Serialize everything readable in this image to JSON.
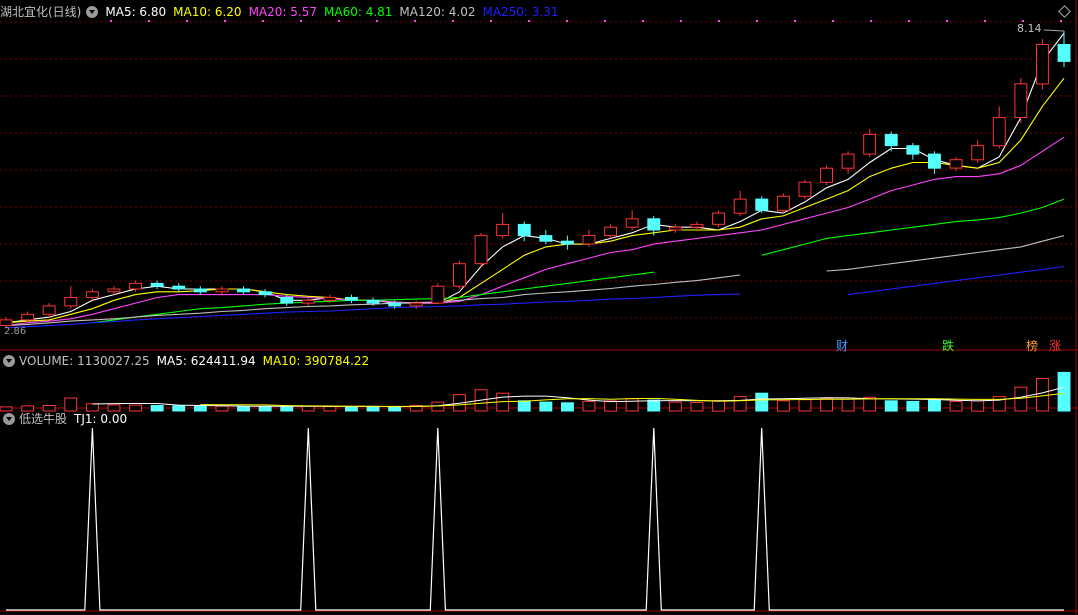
{
  "stock": {
    "name": "湖北宜化(日线)"
  },
  "main_legend": [
    {
      "label": "MA5: 6.80",
      "color": "#ffffff"
    },
    {
      "label": "MA10: 6.20",
      "color": "#ffff00"
    },
    {
      "label": "MA20: 5.57",
      "color": "#ff44ff"
    },
    {
      "label": "MA60: 4.81",
      "color": "#00ff00"
    },
    {
      "label": "MA120: 4.02",
      "color": "#c0c0c0"
    },
    {
      "label": "MA250: 3.31",
      "color": "#2020ff"
    }
  ],
  "volume_legend": {
    "volume": "VOLUME: 1130027.25",
    "ma5": "MA5: 624411.94",
    "ma10": "MA10: 390784.22"
  },
  "indicator_legend": {
    "name": "低选牛股",
    "tj1": "TJ1: 0.00"
  },
  "price_high_label": "8.14",
  "price_low_label": "2.86",
  "event_tags": [
    {
      "label": "财",
      "color": "#3aa0ff"
    },
    {
      "label": "跌",
      "color": "#33ff33"
    },
    {
      "label": "榜",
      "color": "#ff9933"
    },
    {
      "label": "涨",
      "color": "#ff3333"
    }
  ],
  "colors": {
    "up": "#ff3333",
    "down": "#54ffff",
    "grid": "#7a0000",
    "divider": "#a00000"
  },
  "chart_data": [
    {
      "type": "line",
      "title": "湖北宜化(日线)",
      "series": [
        {
          "name": "MA5",
          "values": [
            2.95,
            3.0,
            3.05,
            3.15,
            3.35,
            3.45,
            3.55,
            3.6,
            3.55,
            3.55,
            3.55,
            3.55,
            3.5,
            3.35,
            3.35,
            3.4,
            3.35,
            3.35,
            3.3,
            3.3,
            3.3,
            3.5,
            3.95,
            4.3,
            4.5,
            4.45,
            4.35,
            4.35,
            4.45,
            4.55,
            4.7,
            4.65,
            4.65,
            4.6,
            4.75,
            4.95,
            4.9,
            5.1,
            5.35,
            5.5,
            5.8,
            6.05,
            6.05,
            5.85,
            5.75,
            5.7,
            5.9,
            6.6,
            7.6,
            8.1
          ]
        },
        {
          "name": "MA10",
          "values": [
            2.95,
            2.98,
            3.0,
            3.1,
            3.2,
            3.35,
            3.45,
            3.5,
            3.5,
            3.52,
            3.55,
            3.55,
            3.5,
            3.45,
            3.42,
            3.4,
            3.35,
            3.35,
            3.32,
            3.3,
            3.3,
            3.4,
            3.65,
            3.9,
            4.15,
            4.3,
            4.35,
            4.35,
            4.4,
            4.5,
            4.55,
            4.6,
            4.6,
            4.6,
            4.65,
            4.8,
            4.85,
            5.0,
            5.15,
            5.3,
            5.55,
            5.7,
            5.8,
            5.8,
            5.75,
            5.7,
            5.8,
            6.2,
            6.8,
            7.3
          ]
        },
        {
          "name": "MA20",
          "values": [
            2.9,
            2.95,
            2.98,
            3.02,
            3.1,
            3.2,
            3.3,
            3.4,
            3.45,
            3.45,
            3.45,
            3.45,
            3.45,
            3.42,
            3.4,
            3.38,
            3.35,
            3.35,
            3.32,
            3.3,
            3.3,
            3.33,
            3.45,
            3.6,
            3.75,
            3.9,
            4.0,
            4.1,
            4.2,
            4.25,
            4.35,
            4.4,
            4.45,
            4.5,
            4.55,
            4.6,
            4.7,
            4.8,
            4.9,
            5.0,
            5.15,
            5.3,
            5.4,
            5.5,
            5.55,
            5.55,
            5.6,
            5.75,
            6.0,
            6.25
          ]
        },
        {
          "name": "MA60",
          "values": [
            null,
            null,
            null,
            null,
            2.95,
            3.0,
            3.05,
            3.1,
            3.15,
            3.2,
            3.22,
            3.25,
            3.28,
            3.3,
            3.32,
            3.33,
            3.35,
            3.35,
            3.36,
            3.37,
            3.38,
            3.4,
            3.45,
            3.5,
            3.55,
            3.6,
            3.65,
            3.7,
            3.75,
            3.8,
            3.85,
            null,
            null,
            null,
            null,
            4.15,
            4.25,
            4.35,
            4.45,
            4.5,
            4.55,
            4.6,
            4.65,
            4.7,
            4.75,
            4.78,
            4.82,
            4.9,
            5.0,
            5.15
          ]
        },
        {
          "name": "MA120",
          "values": [
            2.9,
            2.92,
            2.95,
            2.98,
            3.0,
            3.02,
            3.05,
            3.08,
            3.1,
            3.12,
            3.15,
            3.17,
            3.2,
            3.22,
            3.24,
            3.25,
            3.27,
            3.28,
            3.3,
            3.31,
            3.32,
            3.35,
            3.38,
            3.4,
            3.45,
            3.48,
            3.5,
            3.53,
            3.56,
            3.6,
            3.63,
            3.67,
            3.7,
            3.75,
            3.8,
            null,
            null,
            null,
            3.87,
            3.9,
            3.95,
            4.0,
            4.05,
            4.1,
            4.15,
            4.2,
            4.25,
            4.3,
            4.4,
            4.5
          ]
        },
        {
          "name": "MA250",
          "values": [
            2.86,
            2.88,
            2.9,
            2.92,
            2.95,
            2.97,
            3.0,
            3.02,
            3.04,
            3.06,
            3.08,
            3.1,
            3.12,
            3.14,
            3.15,
            3.16,
            3.18,
            3.2,
            3.22,
            3.23,
            3.24,
            3.25,
            3.27,
            3.28,
            3.3,
            3.32,
            3.33,
            3.35,
            3.37,
            3.38,
            3.4,
            3.42,
            3.44,
            3.45,
            3.46,
            null,
            null,
            null,
            null,
            3.45,
            3.5,
            3.55,
            3.6,
            3.65,
            3.7,
            3.75,
            3.8,
            3.85,
            3.9,
            3.95
          ]
        }
      ],
      "candles": [
        [
          2.9,
          3.0,
          2.85,
          3.05
        ],
        [
          3.0,
          3.1,
          2.95,
          3.15
        ],
        [
          3.1,
          3.25,
          3.05,
          3.3
        ],
        [
          3.25,
          3.4,
          3.2,
          3.6
        ],
        [
          3.4,
          3.5,
          3.35,
          3.55
        ],
        [
          3.5,
          3.55,
          3.45,
          3.6
        ],
        [
          3.55,
          3.65,
          3.5,
          3.7
        ],
        [
          3.65,
          3.6,
          3.55,
          3.7
        ],
        [
          3.6,
          3.55,
          3.5,
          3.65
        ],
        [
          3.55,
          3.5,
          3.45,
          3.6
        ],
        [
          3.5,
          3.55,
          3.45,
          3.6
        ],
        [
          3.55,
          3.5,
          3.45,
          3.6
        ],
        [
          3.5,
          3.45,
          3.4,
          3.55
        ],
        [
          3.4,
          3.3,
          3.25,
          3.45
        ],
        [
          3.3,
          3.35,
          3.25,
          3.4
        ],
        [
          3.35,
          3.4,
          3.3,
          3.45
        ],
        [
          3.4,
          3.35,
          3.3,
          3.45
        ],
        [
          3.35,
          3.3,
          3.25,
          3.4
        ],
        [
          3.3,
          3.25,
          3.2,
          3.35
        ],
        [
          3.25,
          3.3,
          3.2,
          3.35
        ],
        [
          3.3,
          3.6,
          3.28,
          3.65
        ],
        [
          3.6,
          4.0,
          3.55,
          4.05
        ],
        [
          4.0,
          4.5,
          3.95,
          4.55
        ],
        [
          4.5,
          4.7,
          4.45,
          4.9
        ],
        [
          4.7,
          4.5,
          4.4,
          4.75
        ],
        [
          4.5,
          4.4,
          4.35,
          4.6
        ],
        [
          4.4,
          4.35,
          4.25,
          4.5
        ],
        [
          4.35,
          4.5,
          4.3,
          4.6
        ],
        [
          4.5,
          4.65,
          4.45,
          4.7
        ],
        [
          4.65,
          4.8,
          4.6,
          4.95
        ],
        [
          4.8,
          4.6,
          4.5,
          4.85
        ],
        [
          4.6,
          4.65,
          4.55,
          4.7
        ],
        [
          4.65,
          4.7,
          4.6,
          4.75
        ],
        [
          4.7,
          4.9,
          4.65,
          4.95
        ],
        [
          4.9,
          5.15,
          4.85,
          5.3
        ],
        [
          5.15,
          4.95,
          4.9,
          5.2
        ],
        [
          4.95,
          5.2,
          4.9,
          5.25
        ],
        [
          5.2,
          5.45,
          5.15,
          5.5
        ],
        [
          5.45,
          5.7,
          5.4,
          5.75
        ],
        [
          5.7,
          5.95,
          5.6,
          6.0
        ],
        [
          5.95,
          6.3,
          5.9,
          6.4
        ],
        [
          6.3,
          6.1,
          6.0,
          6.35
        ],
        [
          6.1,
          5.95,
          5.85,
          6.15
        ],
        [
          5.95,
          5.7,
          5.6,
          6.0
        ],
        [
          5.7,
          5.85,
          5.65,
          5.9
        ],
        [
          5.85,
          6.1,
          5.8,
          6.2
        ],
        [
          6.1,
          6.6,
          6.05,
          6.8
        ],
        [
          6.6,
          7.2,
          6.5,
          7.3
        ],
        [
          7.2,
          7.9,
          7.1,
          8.0
        ],
        [
          7.9,
          7.6,
          7.5,
          8.14
        ]
      ],
      "candle_fields": [
        "open",
        "close",
        "low",
        "high"
      ],
      "ylim": [
        2.75,
        8.3
      ],
      "grid": true
    },
    {
      "type": "bar",
      "title": "VOLUME",
      "values": [
        120,
        150,
        160,
        380,
        210,
        180,
        170,
        160,
        150,
        140,
        140,
        130,
        130,
        150,
        140,
        130,
        120,
        130,
        120,
        160,
        260,
        480,
        620,
        520,
        300,
        260,
        240,
        280,
        300,
        360,
        320,
        260,
        250,
        300,
        420,
        520,
        300,
        330,
        360,
        380,
        400,
        300,
        280,
        320,
        280,
        300,
        420,
        700,
        950,
        1130
      ],
      "series": [
        {
          "name": "MA5",
          "values": [
            null,
            null,
            null,
            null,
            204,
            216,
            220,
            220,
            174,
            160,
            152,
            144,
            138,
            140,
            138,
            136,
            134,
            136,
            130,
            132,
            152,
            224,
            318,
            408,
            436,
            436,
            388,
            320,
            276,
            288,
            300,
            304,
            298,
            298,
            310,
            350,
            358,
            374,
            386,
            382,
            358,
            354,
            348,
            336,
            316,
            296,
            320,
            404,
            530,
            700
          ]
        },
        {
          "name": "MA10",
          "values": [
            null,
            null,
            null,
            null,
            null,
            null,
            null,
            null,
            null,
            186,
            184,
            182,
            179,
            157,
            150,
            146,
            141,
            138,
            135,
            136,
            145,
            180,
            227,
            274,
            286,
            326,
            356,
            364,
            342,
            362,
            368,
            346,
            309,
            287,
            299,
            325,
            331,
            336,
            342,
            346,
            354,
            356,
            361,
            361,
            349,
            339,
            339,
            376,
            442,
            518
          ]
        }
      ],
      "ylim": [
        0,
        1200
      ]
    },
    {
      "type": "line",
      "title": "低选牛股",
      "series": [
        {
          "name": "TJ1",
          "values": [
            0,
            0,
            0,
            0,
            0,
            0,
            0,
            0,
            0,
            0,
            0,
            0,
            0,
            0,
            0,
            0,
            0,
            0,
            0,
            0,
            0,
            0,
            0,
            0,
            0,
            0,
            0,
            0,
            0,
            0,
            0,
            0,
            0,
            0,
            0,
            0,
            0,
            0,
            0,
            0,
            0,
            0,
            0,
            0,
            0,
            0,
            0,
            0,
            0,
            0
          ]
        }
      ],
      "signals": [
        4,
        14,
        20,
        30,
        35
      ],
      "ylim": [
        0,
        1
      ]
    }
  ]
}
